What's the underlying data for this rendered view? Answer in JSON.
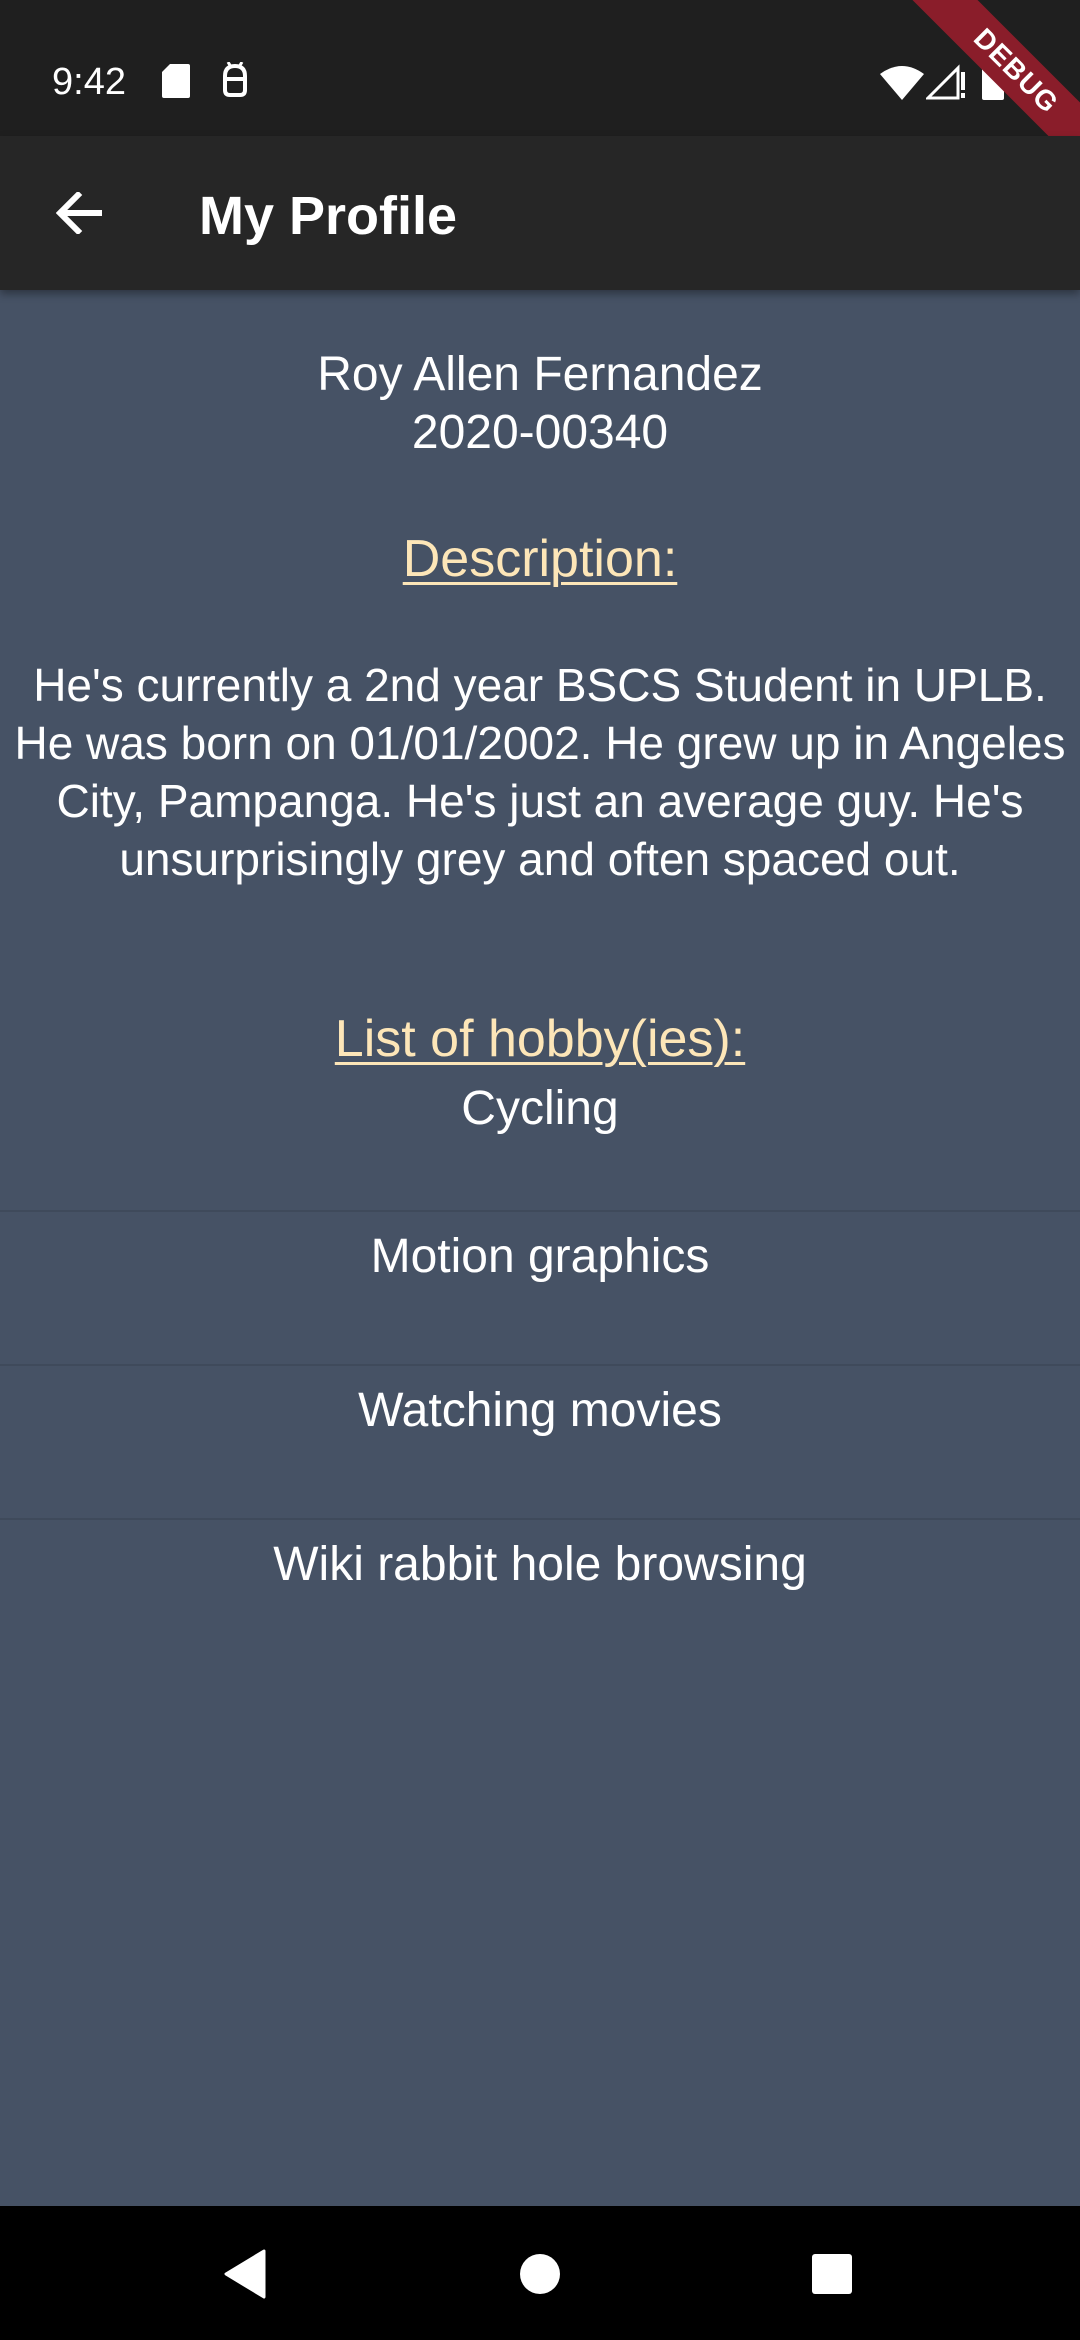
{
  "status_bar": {
    "time": "9:42",
    "icons": [
      "sdcard-icon",
      "android-icon",
      "wifi-icon",
      "signal-icon",
      "battery-icon"
    ]
  },
  "debug_banner": {
    "label": "DEBUG"
  },
  "app_bar": {
    "back_icon": "arrow-back-icon",
    "title": "My Profile"
  },
  "profile": {
    "name": "Roy Allen Fernandez",
    "student_id": "2020-00340",
    "description_heading": "Description:",
    "description": "He's currently a 2nd year BSCS Student in UPLB. He was born on 01/01/2002. He grew up in Angeles City, Pampanga. He's just an average guy. He's unsurprisingly grey and often spaced out.",
    "hobbies_heading": "List of hobby(ies):",
    "hobbies": [
      "Cycling",
      "Motion graphics",
      "Watching movies",
      "Wiki rabbit hole browsing"
    ]
  },
  "nav_bar": {
    "buttons": [
      "back-triangle-icon",
      "home-circle-icon",
      "recents-square-icon"
    ]
  },
  "colors": {
    "background": "#465265",
    "app_bar": "#262626",
    "status_bar": "#1f1f1f",
    "heading": "#fde6b8",
    "debug": "#8a1d2a"
  }
}
